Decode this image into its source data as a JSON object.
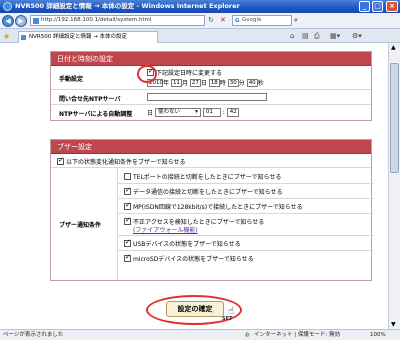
{
  "window": {
    "title": "NVR500 詳細設定と情報 → 本体の設定 - Windows Internet Explorer"
  },
  "toolbar": {
    "url": "http://192.168.100.1/detail/system.html",
    "search_placeholder": "Google"
  },
  "tab": {
    "label": "NVR500 詳細設定と情報 → 本体の設定"
  },
  "datetime": {
    "heading": "日付と時刻の設定",
    "manual": {
      "label": "手動設定",
      "checkbox_label": "下記設定日時に変更する",
      "year": "2010",
      "year_unit": "年",
      "month": "11",
      "month_unit": "月",
      "day": "27",
      "day_unit": "日",
      "hour": "18",
      "hour_unit": "時",
      "minute": "30",
      "minute_unit": "分",
      "second": "40",
      "second_unit": "秒"
    },
    "ntp_server": {
      "label": "問い合せ先NTPサーバ",
      "value": ""
    },
    "ntp_auto": {
      "label": "NTPサーバによる自動調整",
      "day_prefix": "日",
      "day_value": "使わない",
      "hour": "01",
      "minute": "42"
    }
  },
  "buzzer": {
    "heading": "ブザー設定",
    "master_label": "以下の状態変化通知条件をブザーで知らせる",
    "conditions_label": "ブザー通知条件",
    "items": [
      {
        "label": "TELポートの接続と切断をしたときにブザーで知らせる",
        "checked": false
      },
      {
        "label": "データ通信の接続と切断をしたときにブザーで知らせる",
        "checked": true
      },
      {
        "label": "MP(ISDN回線で128kbit/s)で接続したときにブザーで知らせる",
        "checked": true
      },
      {
        "label": "不正アクセスを検知したときにブザーで知らせる",
        "checked": true,
        "link": "(ファイアウォール機能)"
      },
      {
        "label": "USBデバイスの状態をブザーで知らせる",
        "checked": true
      },
      {
        "label": "microSDデバイスの状態をブザーで知らせる",
        "checked": true
      }
    ]
  },
  "confirm_button": {
    "label": "設定の確定",
    "tag": "SET"
  },
  "status": {
    "left": "ページが表示されました",
    "zone": "インターネット | 保護モード: 無効",
    "zoom": "100%"
  }
}
